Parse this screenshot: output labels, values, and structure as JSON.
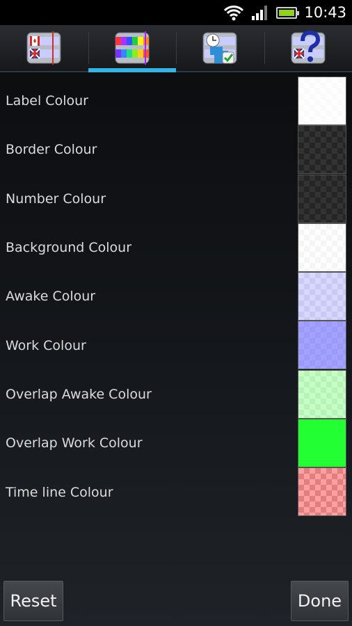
{
  "status_bar": {
    "time": "10:43",
    "icons": [
      "wifi-icon",
      "signal-icon",
      "battery-icon"
    ],
    "battery_color": "#8fd41c"
  },
  "tabs": [
    {
      "icon": "timezone-clock-icon",
      "active": false
    },
    {
      "icon": "colour-palette-icon",
      "active": true
    },
    {
      "icon": "alarm-settings-icon",
      "active": false
    },
    {
      "icon": "help-icon",
      "active": false
    }
  ],
  "accent_color": "#33b5e5",
  "settings": [
    {
      "label": "Label Colour",
      "color": "rgba(255,255,255,0.92)"
    },
    {
      "label": "Border Colour",
      "color": "rgba(0,0,0,0.80)"
    },
    {
      "label": "Number Colour",
      "color": "rgba(0,0,0,0.80)"
    },
    {
      "label": "Background Colour",
      "color": "rgba(255,255,255,0.85)"
    },
    {
      "label": "Awake Colour",
      "color": "rgba(205,205,255,0.80)"
    },
    {
      "label": "Work Colour",
      "color": "rgba(150,150,255,0.88)"
    },
    {
      "label": "Overlap Awake Colour",
      "color": "rgba(185,255,185,0.82)"
    },
    {
      "label": "Overlap Work Colour",
      "color": "#22ff33"
    },
    {
      "label": "Time line Colour",
      "color": "rgba(255,80,80,0.55)"
    }
  ],
  "buttons": {
    "reset_label": "Reset",
    "done_label": "Done"
  }
}
